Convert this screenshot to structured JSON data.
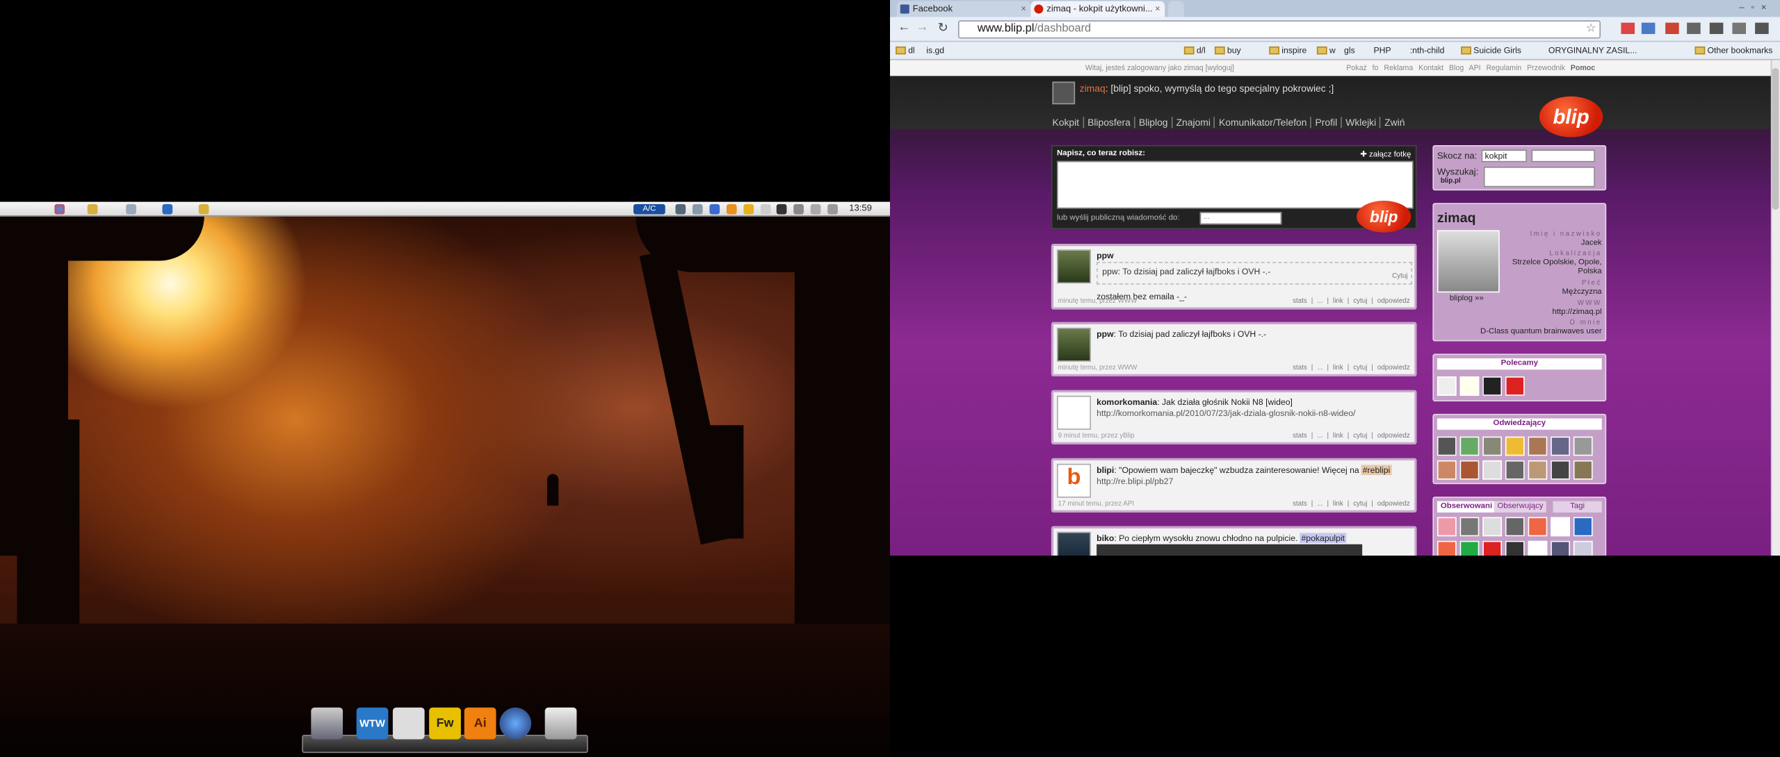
{
  "desktop": {
    "panel_clock": "13:59",
    "keyboard_indicator": "A/C",
    "dock_items": [
      {
        "icon": "computer-icon",
        "label": ""
      },
      {
        "icon": "wtw-icon",
        "label": "WTW"
      },
      {
        "icon": "alien-icon",
        "label": ""
      },
      {
        "icon": "fireworks-icon",
        "label": "Fw"
      },
      {
        "icon": "illustrator-icon",
        "label": "Ai"
      },
      {
        "icon": "thunderbird-icon",
        "label": ""
      },
      {
        "icon": "trash-icon",
        "label": ""
      }
    ]
  },
  "browser": {
    "tabs": [
      {
        "label": "Facebook",
        "active": false
      },
      {
        "label": "zimaq - kokpit użytkowni...",
        "active": true
      }
    ],
    "url_host": "www.blip.pl",
    "url_path": "/dashboard",
    "bookmarks": [
      "dl",
      "is.gd",
      "d/l",
      "buy",
      "inspire",
      "w",
      "gls",
      "PHP",
      ":nth-child",
      "Suicide Girls",
      "ORYGINALNY ZASIL..."
    ],
    "other_bookmarks": "Other bookmarks"
  },
  "page": {
    "welcome": "Witaj, jesteś zalogowany jako zimaq [wyloguj]",
    "top_links": [
      "Pokaż fo",
      "Reklama",
      "Kontakt",
      "Blog",
      "API",
      "Regulamin",
      "Przewodnik"
    ],
    "help": "Pomoc",
    "status_user": "zimaq",
    "status_text": ": [blip] spoko, wymyślą do tego specjalny pokrowiec ;]",
    "nav": [
      "Kokpit",
      "Bliposfera",
      "Bliplog",
      "Znajomi",
      "Komunikator/Telefon",
      "Profil",
      "Wklejki",
      "Zwiń"
    ],
    "logo": "blip",
    "compose": {
      "label": "Napisz, co teraz robisz:",
      "attach": "✚ załącz fotkę",
      "public": "lub wyślij publiczną wiadomość do:",
      "select": "..."
    },
    "posts": [
      {
        "user": "ppw",
        "quote": "ppw: To dzisiaj pad zaliczył łajfboks i OVH -.-",
        "quote_action": "Cytuj",
        "body": "zostałem bez emaila -_-",
        "meta": "minutę temu, przez WWW",
        "actions": "stats | ... | link | cytuj | odpowiedz"
      },
      {
        "user": "ppw",
        "body": ": To dzisiaj pad zaliczył łajfboks i OVH -.-",
        "meta": "minutę temu, przez WWW",
        "actions": "stats | ... | link | cytuj | odpowiedz"
      },
      {
        "user": "komorkomania",
        "body": ": Jak działa głośnik Nokii N8 [wideo]",
        "link": "http://komorkomania.pl/2010/07/23/jak-dziala-glosnik-nokii-n8-wideo/",
        "meta": "9 minut temu, przez yBlip",
        "actions": "stats | ... | link | cytuj | odpowiedz"
      },
      {
        "user": "blipi",
        "body": ": \"Opowiem wam bajeczkę\" wzbudza zainteresowanie! Więcej na ",
        "tag": "#reblipi",
        "link": "http://re.blipi.pl/pb27",
        "meta": "17 minut temu, przez API",
        "actions": "stats | ... | link | cytuj | odpowiedz"
      },
      {
        "user": "biko",
        "body": ": Po ciepłym wysokłu znowu chłodno na pulpicie. ",
        "tag": "#pokapulpit"
      }
    ],
    "sidebar": {
      "jump_label": "Skocz na:",
      "jump_value": "kokpit",
      "search_label": "Wyszukaj:",
      "search_scope": "blip.pl",
      "profile": {
        "name": "zimaq",
        "bliplog": "bliplog »»",
        "fields": [
          {
            "label": "Imię i nazwisko",
            "value": "Jacek"
          },
          {
            "label": "Lokalizacja",
            "value": "Strzelce Opolskie, Opole, Polska"
          },
          {
            "label": "Płeć",
            "value": "Mężczyzna"
          },
          {
            "label": "WWW",
            "value": "http://zimaq.pl"
          },
          {
            "label": "O mnie",
            "value": "D-Class quantum brainwaves user"
          }
        ]
      },
      "recommended": "Polecamy",
      "visitors": "Odwiedzający",
      "follow_tabs": [
        "Obserwowani",
        "Obserwujący",
        "Tagi"
      ]
    }
  },
  "colors": {
    "blip_red": "#d21c06",
    "page_purple": "#7a2082",
    "tab_active": "#f0f4fa"
  }
}
